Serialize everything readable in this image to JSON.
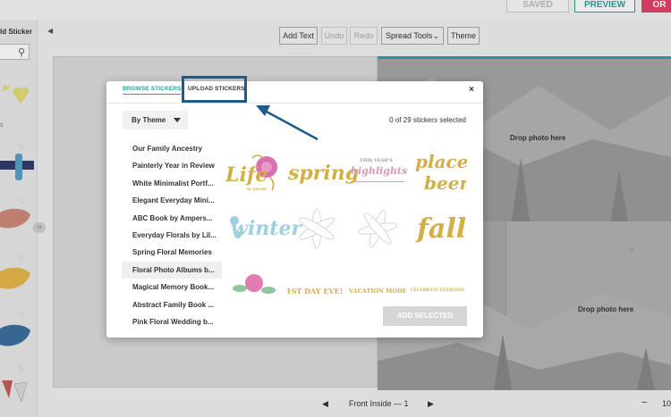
{
  "header": {
    "saved_label": "SAVED",
    "preview_label": "PREVIEW",
    "order_label": "OR"
  },
  "sidebar": {
    "title": "ld Sticker",
    "search_placeholder": ""
  },
  "toolbar": {
    "add_text": "Add Text",
    "undo": "Undo",
    "redo": "Redo",
    "spread_tools": "Spread Tools",
    "theme": "Theme"
  },
  "canvas": {
    "drop_photo_top": "Drop photo here",
    "drop_photo_bottom": "Drop photo here"
  },
  "bottom_nav": {
    "page_indicator": "Front Inside — 1",
    "zoom": "10"
  },
  "modal": {
    "tabs": [
      {
        "label": "BROWSE STICKERS",
        "active": true
      },
      {
        "label": "UPLOAD STICKERS",
        "active": false
      }
    ],
    "close_label": "×",
    "theme_dropdown": "By Theme",
    "selected_count": "0 of 29 stickers selected",
    "themes": [
      "Our Family Ancestry",
      "Painterly Year in Review",
      "White Minimalist Portf...",
      "Elegant Everyday Mini...",
      "ABC Book by Ampers...",
      "Everyday Florals by Lil...",
      "Spring Floral Memories",
      "Floral Photo Albums b...",
      "Magical Memory Book...",
      "Abstract Family Book ...",
      "Pink Floral Wedding b..."
    ],
    "active_theme_index": 7,
    "stickers": [
      {
        "text": "Life",
        "sub": "is sweet"
      },
      {
        "text": "spring"
      },
      {
        "text": "highlights",
        "sub": "THIS YEAR'S"
      },
      {
        "text": "places",
        "sub": "been"
      },
      {
        "text": "winter"
      },
      {
        "text": ""
      },
      {
        "text": ""
      },
      {
        "text": "fall"
      },
      {
        "text": ""
      },
      {
        "text": "1ST DAY EVE!"
      },
      {
        "text": "VACATION MODE"
      },
      {
        "text": "CELEBRATE EVERYDAY"
      }
    ],
    "add_button": "ADD SELECTED"
  },
  "colors": {
    "accent": "#2aa3a0",
    "annotation": "#1f5b8a",
    "gold": "#d3b047",
    "order_pink": "#e4416b"
  }
}
